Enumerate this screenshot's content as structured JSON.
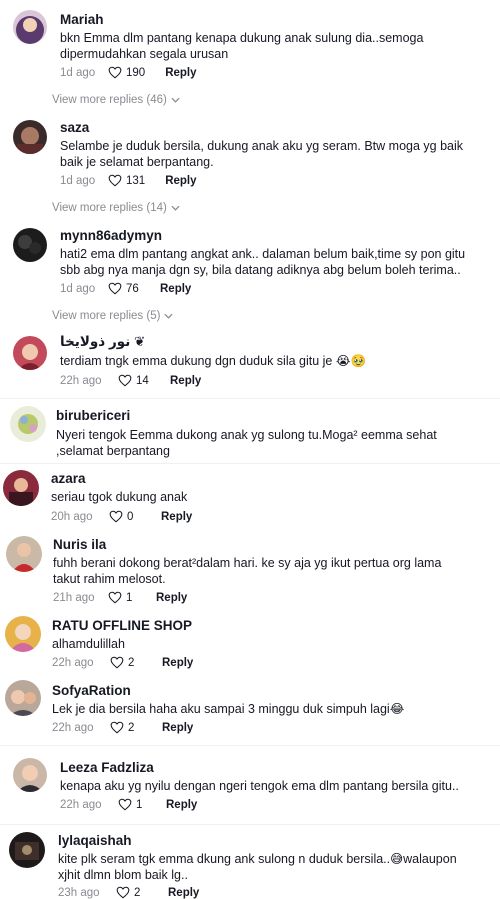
{
  "comments": [
    {
      "username": "Mariah",
      "text": [
        "bkn Emma dlm pantang kenapa dukung anak sulung dia..semoga",
        "dipermudahkan segala urusan"
      ],
      "time": "1d ago",
      "likes": "190",
      "reply": "Reply",
      "view_more": "View more replies (46)"
    },
    {
      "username": "saza",
      "text": [
        "Selambe je duduk bersila, dukung anak aku yg seram. Btw moga yg baik",
        "baik je selamat berpantang."
      ],
      "time": "1d ago",
      "likes": "131",
      "reply": "Reply",
      "view_more": "View more replies (14)"
    },
    {
      "username": "mynn86adymyn",
      "text": [
        "hati2 ema dlm pantang angkat ank.. dalaman belum baik,time sy pon gitu",
        "sbb abg nya manja dgn sy, bila datang adiknya abg belum boleh terima.."
      ],
      "time": "1d ago",
      "likes": "76",
      "reply": "Reply",
      "view_more": "View more replies (5)"
    },
    {
      "username": "نور ذولايخا ❦",
      "text": [
        "terdiam tngk emma dukung dgn duduk sila gitu je 😭🥹"
      ],
      "time": "22h ago",
      "likes": "14",
      "reply": "Reply"
    },
    {
      "username": "birubericeri",
      "text": [
        "Nyeri tengok Eemma dukong anak yg sulong tu.Moga² eemma sehat",
        ",selamat berpantang"
      ],
      "time": "",
      "likes": "",
      "reply": ""
    },
    {
      "username": "azara",
      "text": [
        "seriau tgok dukung anak"
      ],
      "time": "20h ago",
      "likes": "0",
      "reply": "Reply"
    },
    {
      "username": "Nuris ila",
      "text": [
        "fuhh berani dokong berat²dalam hari. ke sy aja yg ikut pertua org lama",
        "takut rahim melosot."
      ],
      "time": "21h ago",
      "likes": "1",
      "reply": "Reply"
    },
    {
      "username": "RATU OFFLINE SHOP",
      "text": [
        "alhamdulillah"
      ],
      "time": "22h ago",
      "likes": "2",
      "reply": "Reply"
    },
    {
      "username": "SofyaRation",
      "text": [
        "Lek je dia bersila haha aku sampai 3 minggu duk simpuh lagi😂"
      ],
      "time": "22h ago",
      "likes": "2",
      "reply": "Reply"
    },
    {
      "username": "Leeza Fadzliza",
      "text": [
        "kenapa aku yg nyilu dengan ngeri tengok ema dlm pantang bersila gitu.."
      ],
      "time": "22h ago",
      "likes": "1",
      "reply": "Reply"
    },
    {
      "username": "lylaqaishah",
      "text": [
        "kite plk seram tgk emma dkung ank sulong n duduk bersila..😅walaupon",
        "xjhit dlmn blom baik lg.."
      ],
      "time": "23h ago",
      "likes": "2",
      "reply": "Reply"
    }
  ],
  "colors": {
    "text": "#161823",
    "muted": "#8a8b91",
    "divider": "#f1f1f2"
  }
}
